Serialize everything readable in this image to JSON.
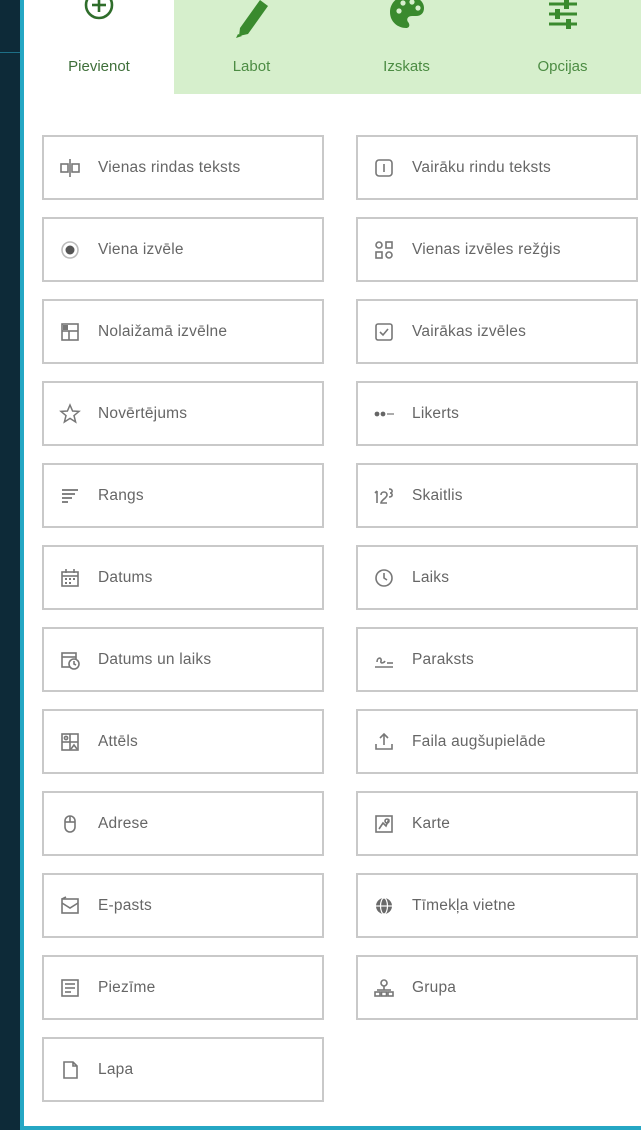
{
  "tabs": [
    {
      "label": "Pievienot",
      "icon": "add-circle-icon"
    },
    {
      "label": "Labot",
      "icon": "pencil-icon"
    },
    {
      "label": "Izskats",
      "icon": "palette-icon"
    },
    {
      "label": "Opcijas",
      "icon": "sliders-icon"
    }
  ],
  "items": [
    {
      "label": "Vienas rindas teksts",
      "icon": "single-line-text-icon"
    },
    {
      "label": "Vairāku rindu teksts",
      "icon": "multi-line-text-icon"
    },
    {
      "label": "Viena izvēle",
      "icon": "radio-button-icon"
    },
    {
      "label": "Vienas izvēles režģis",
      "icon": "choice-grid-icon"
    },
    {
      "label": "Nolaižamā izvēlne",
      "icon": "dropdown-icon"
    },
    {
      "label": "Vairākas izvēles",
      "icon": "checkbox-icon"
    },
    {
      "label": "Novērtējums",
      "icon": "star-icon"
    },
    {
      "label": "Likerts",
      "icon": "likert-icon"
    },
    {
      "label": "Rangs",
      "icon": "ranking-icon"
    },
    {
      "label": "Skaitlis",
      "icon": "number-icon"
    },
    {
      "label": "Datums",
      "icon": "calendar-icon"
    },
    {
      "label": "Laiks",
      "icon": "clock-icon"
    },
    {
      "label": "Datums un laiks",
      "icon": "calendar-clock-icon"
    },
    {
      "label": "Paraksts",
      "icon": "signature-icon"
    },
    {
      "label": "Attēls",
      "icon": "image-icon"
    },
    {
      "label": "Faila augšupielāde",
      "icon": "upload-icon"
    },
    {
      "label": "Adrese",
      "icon": "mouse-icon"
    },
    {
      "label": "Karte",
      "icon": "map-icon"
    },
    {
      "label": "E-pasts",
      "icon": "email-icon"
    },
    {
      "label": "Tīmekļa vietne",
      "icon": "globe-icon"
    },
    {
      "label": "Piezīme",
      "icon": "note-icon"
    },
    {
      "label": "Grupa",
      "icon": "group-icon"
    },
    {
      "label": "Lapa",
      "icon": "page-icon"
    }
  ],
  "colors": {
    "accent_green": "#3a8a2e",
    "tab_inactive_bg": "#d6efcc",
    "panel_border": "#25a7c4",
    "item_border": "#c9c9c9"
  }
}
